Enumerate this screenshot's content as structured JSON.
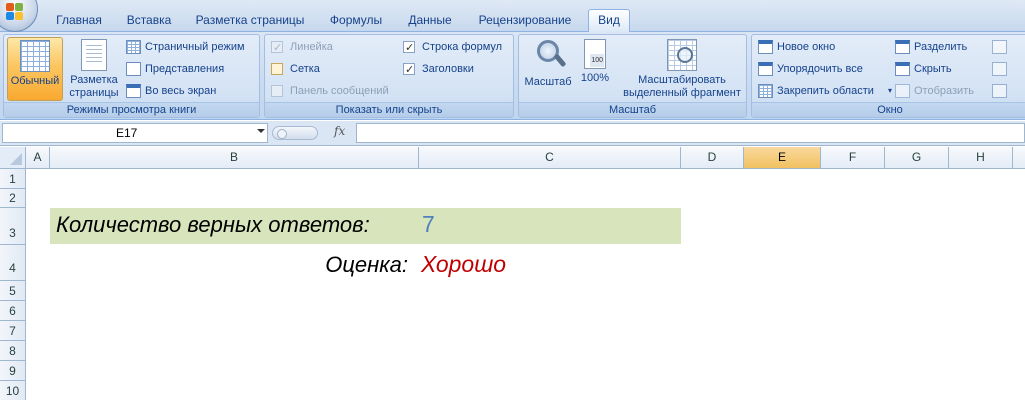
{
  "tabs": [
    "Главная",
    "Вставка",
    "Разметка страницы",
    "Формулы",
    "Данные",
    "Рецензирование",
    "Вид"
  ],
  "active_tab": "Вид",
  "ribbon": {
    "view_modes": {
      "group_label": "Режимы просмотра книги",
      "normal": "Обычный",
      "page_layout_line1": "Разметка",
      "page_layout_line2": "страницы",
      "page_break": "Страничный режим",
      "views": "Представления",
      "full_screen": "Во весь экран"
    },
    "show_hide": {
      "group_label": "Показать или скрыть",
      "ruler": "Линейка",
      "gridlines": "Сетка",
      "message_bar": "Панель сообщений",
      "formula_bar": "Строка формул",
      "headings": "Заголовки",
      "ruler_checked": true,
      "gridlines_checked": false,
      "formula_bar_checked": true,
      "headings_checked": true
    },
    "zoom": {
      "group_label": "Масштаб",
      "zoom": "Масштаб",
      "zoom100": "100%",
      "icon_text": "100",
      "zoom_sel_line1": "Масштабировать",
      "zoom_sel_line2": "выделенный фрагмент"
    },
    "window": {
      "group_label": "Окно",
      "new_window": "Новое окно",
      "arrange_all": "Упорядочить все",
      "freeze_panes": "Закрепить области",
      "split": "Разделить",
      "hide": "Скрыть",
      "unhide": "Отобразить"
    }
  },
  "formula_bar": {
    "name_box": "E17",
    "fx_label": "fx",
    "formula": ""
  },
  "columns": [
    "A",
    "B",
    "C",
    "D",
    "E",
    "F",
    "G",
    "H"
  ],
  "selected_column": "E",
  "rows": [
    "1",
    "2",
    "3",
    "4",
    "5",
    "6",
    "7",
    "8",
    "9",
    "10"
  ],
  "cells": {
    "B3": "Количество верных ответов:",
    "C3": "7",
    "B4": "Оценка:",
    "C4": "Хорошо"
  },
  "colors": {
    "accent": "#15428b",
    "highlight_fill": "#d8e4bc",
    "count_value": "#4f81bd",
    "grade_value": "#c00000",
    "selected_header": "#f1c15f"
  }
}
